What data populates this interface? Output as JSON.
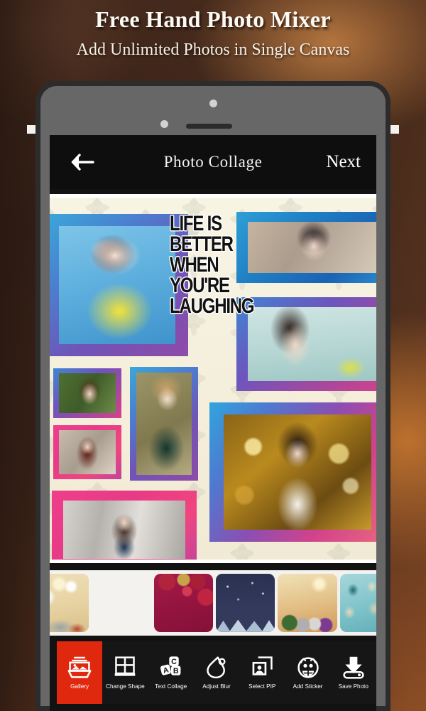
{
  "promo": {
    "title": "Free Hand Photo Mixer",
    "subtitle": "Add Unlimited Photos in Single Canvas"
  },
  "appbar": {
    "back_icon": "arrow-left-icon",
    "title": "Photo Collage",
    "next_label": "Next"
  },
  "canvas": {
    "background_name": "cream-damask-pattern",
    "background_color": "#f6f1de",
    "overlay_text_lines": [
      "LIFE IS",
      "BETTER",
      "WHEN",
      "YOU'RE",
      "LAUGHING"
    ],
    "photos": [
      {
        "id": "photo-woman-sunglasses",
        "frame": "blue-gradient",
        "frame_color": "#2f9fd6"
      },
      {
        "id": "photo-woman-bob-haircut",
        "frame": "blue-gradient",
        "frame_color": "#1f7fc4"
      },
      {
        "id": "photo-woman-looking-up",
        "frame": "purple-blue-gradient",
        "frame_color": "#6f54b8"
      },
      {
        "id": "photo-woman-green-background",
        "frame": "purple-pink-gradient",
        "frame_color": "#a7479d"
      },
      {
        "id": "photo-woman-red-hair",
        "frame": "pink-gradient",
        "frame_color": "#ef3f8c"
      },
      {
        "id": "photo-woman-smiling-blonde",
        "frame": "blue-purple-gradient",
        "frame_color": "#4b7fd0"
      },
      {
        "id": "photo-woman-street",
        "frame": "pink-gradient",
        "frame_color": "#ef3f8c"
      },
      {
        "id": "photo-woman-autumn-bokeh",
        "frame": "multicolor-gradient",
        "frame_color": "#d2428c"
      }
    ]
  },
  "backgrounds": {
    "label": "background-thumbnails",
    "items": [
      {
        "name": "golden-bokeh-star-background",
        "selected": false
      },
      {
        "name": "gold-ornament-baubles-background",
        "selected": false
      },
      {
        "name": "magenta-christmas-baubles-background",
        "selected": false
      },
      {
        "name": "navy-night-mountains-background",
        "selected": false
      },
      {
        "name": "warm-gold-ornaments-pine-background",
        "selected": false
      },
      {
        "name": "teal-hanging-bells-background",
        "selected": false
      }
    ]
  },
  "toolbar": {
    "items": [
      {
        "label": "Gallery",
        "icon": "gallery-icon",
        "active": true
      },
      {
        "label": "Change Shape",
        "icon": "grid-shape-icon",
        "active": false
      },
      {
        "label": "Text Collage",
        "icon": "abc-blocks-icon",
        "active": false
      },
      {
        "label": "Adjust Blur",
        "icon": "water-drop-icon",
        "active": false
      },
      {
        "label": "Select PIP",
        "icon": "picture-in-picture-icon",
        "active": false
      },
      {
        "label": "Add Sticker",
        "icon": "smiley-sticker-icon",
        "active": false
      },
      {
        "label": "Save Photo",
        "icon": "download-save-icon",
        "active": false
      }
    ],
    "active_color": "#e0280f"
  }
}
